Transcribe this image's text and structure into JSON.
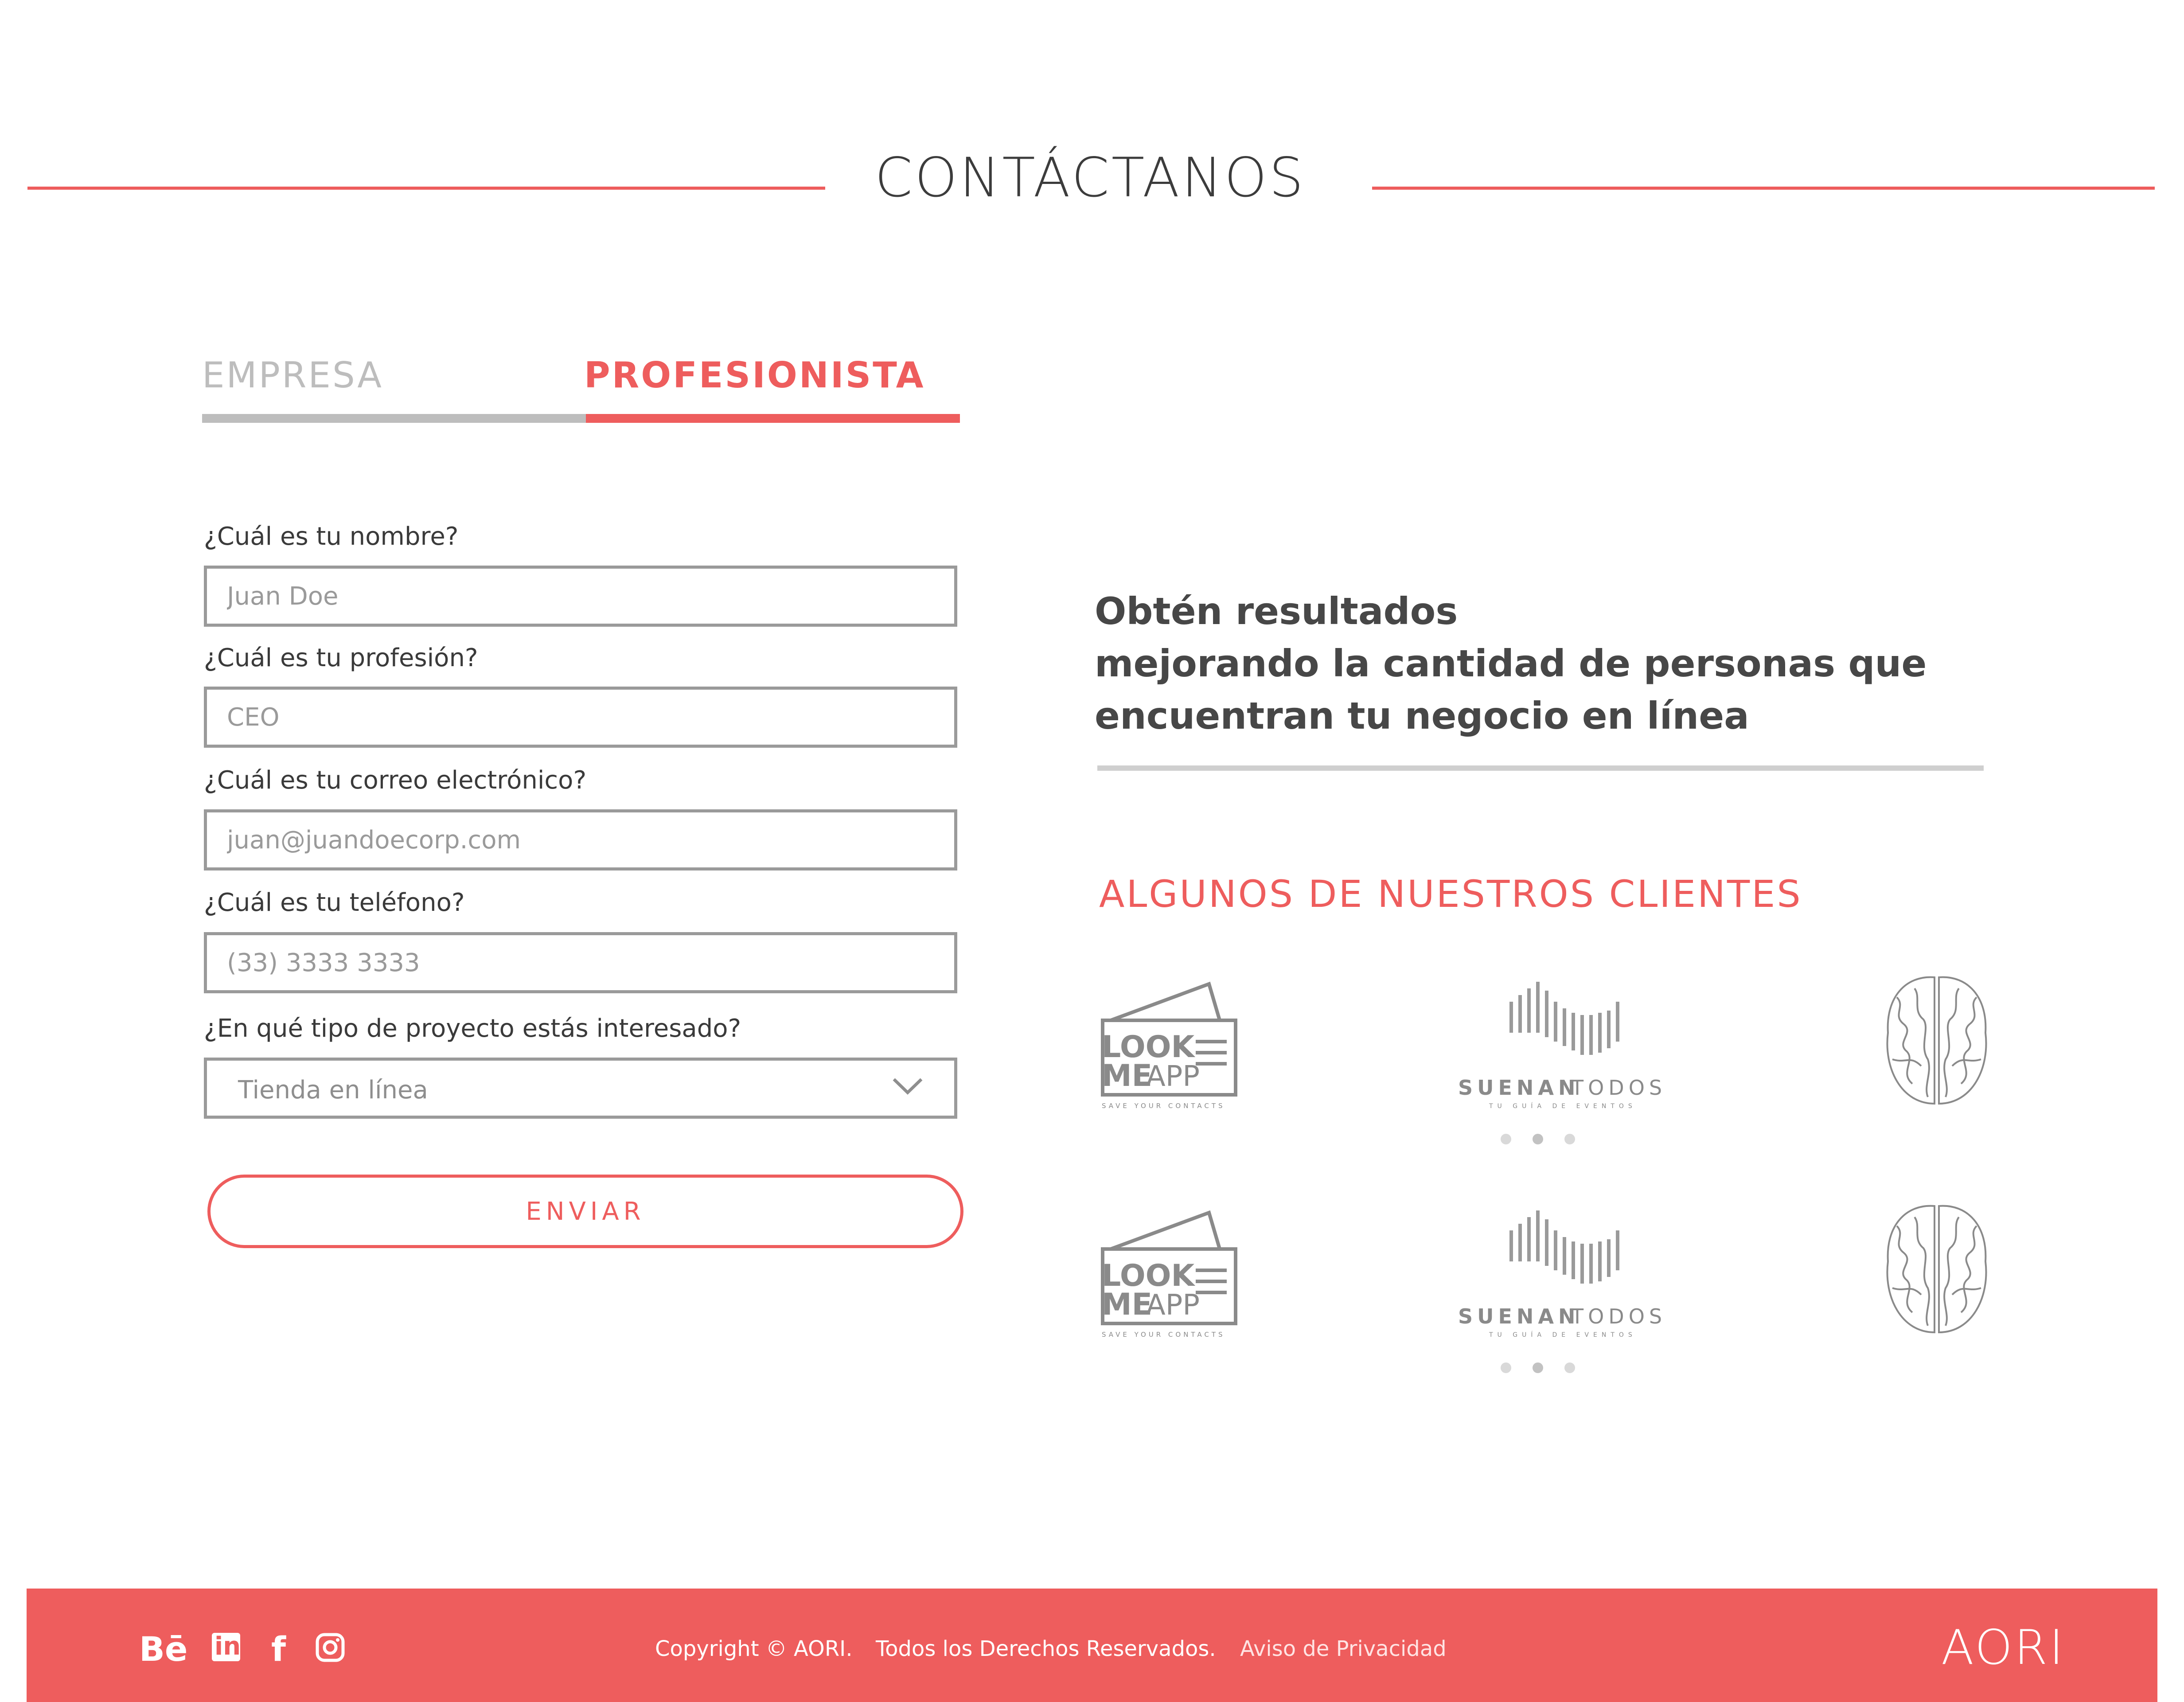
{
  "page": {
    "title": "CONTÁCTANOS"
  },
  "tabs": [
    {
      "label": "EMPRESA",
      "active": false
    },
    {
      "label": "PROFESIONISTA",
      "active": true
    }
  ],
  "form": {
    "name_label": "¿Cuál es tu nombre?",
    "name_placeholder": "Juan Doe",
    "profession_label": "¿Cuál es tu profesión?",
    "profession_placeholder": "CEO",
    "email_label": "¿Cuál es tu correo electrónico?",
    "email_placeholder": "juan@juandoecorp.com",
    "phone_label": "¿Cuál es tu teléfono?",
    "phone_placeholder": "(33) 3333 3333",
    "project_label": "¿En qué tipo de proyecto estás interesado?",
    "project_value": "Tienda en línea",
    "submit_label": "ENVIAR"
  },
  "promo": {
    "line1": "Obtén resultados",
    "line2": "mejorando la cantidad de personas que",
    "line3": "encuentran tu negocio en línea"
  },
  "clients": {
    "title": "ALGUNOS DE NUESTROS CLIENTES",
    "lookme": {
      "line1": "LOOK",
      "line2a": "ME",
      "line2b": "APP",
      "tagline": "SAVE YOUR CONTACTS"
    },
    "suenan": {
      "name_a": "SUENAN",
      "name_b": "TODOS",
      "tagline": "TU GUÍA DE EVENTOS"
    }
  },
  "footer": {
    "copyright": "Copyright © AORI.",
    "rights": "Todos los Derechos Reservados.",
    "privacy": "Aviso de Privacidad",
    "logo": "AORI",
    "behance": "Bē",
    "linkedin": "in",
    "facebook": "f"
  },
  "colors": {
    "accent": "#ee5d5d",
    "muted": "#bdbdbd",
    "border": "#9a9a9a"
  }
}
